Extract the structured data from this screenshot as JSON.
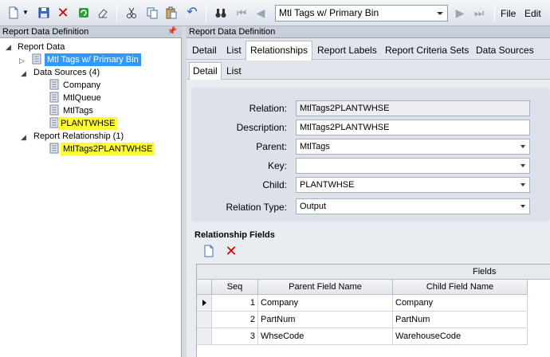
{
  "toolbar": {
    "report_combo_value": "Mtl Tags w/ Primary Bin",
    "menu_file": "File",
    "menu_edit": "Edit"
  },
  "left_pane": {
    "header": "Report Data Definition",
    "tree": {
      "root": "Report Data",
      "report": "Mtl Tags w/ Primary Bin",
      "data_sources": "Data Sources (4)",
      "sources": [
        "Company",
        "MtlQueue",
        "MtlTags",
        "PLANTWHSE"
      ],
      "relationships": "Report Relationship (1)",
      "relationship_items": [
        "MtlTags2PLANTWHSE"
      ]
    }
  },
  "right_pane": {
    "header": "Report Data Definition",
    "tabs": [
      "Detail",
      "List",
      "Relationships",
      "Report Labels",
      "Report Criteria Sets",
      "Data Sources"
    ],
    "subtabs": [
      "Detail",
      "List"
    ],
    "form": {
      "relation_label": "Relation:",
      "relation_value": "MtlTags2PLANTWHSE",
      "description_label": "Description:",
      "description_value": "MtlTags2PLANTWHSE",
      "parent_label": "Parent:",
      "parent_value": "MtlTags",
      "key_label": "Key:",
      "key_value": "",
      "child_label": "Child:",
      "child_value": "PLANTWHSE",
      "relation_type_label": "Relation Type:",
      "relation_type_value": "Output"
    },
    "relationship_fields": {
      "title": "Relationship Fields",
      "group_header": "Fields",
      "columns": [
        "Seq",
        "Parent Field Name",
        "Child Field Name"
      ],
      "rows": [
        {
          "seq": "1",
          "parent": "Company",
          "child": "Company"
        },
        {
          "seq": "2",
          "parent": "PartNum",
          "child": "PartNum"
        },
        {
          "seq": "3",
          "parent": "WhseCode",
          "child": "WarehouseCode"
        }
      ]
    }
  },
  "colors": {
    "selection": "#3399ff",
    "highlight": "#ffff33",
    "delete_red": "#d00000"
  }
}
